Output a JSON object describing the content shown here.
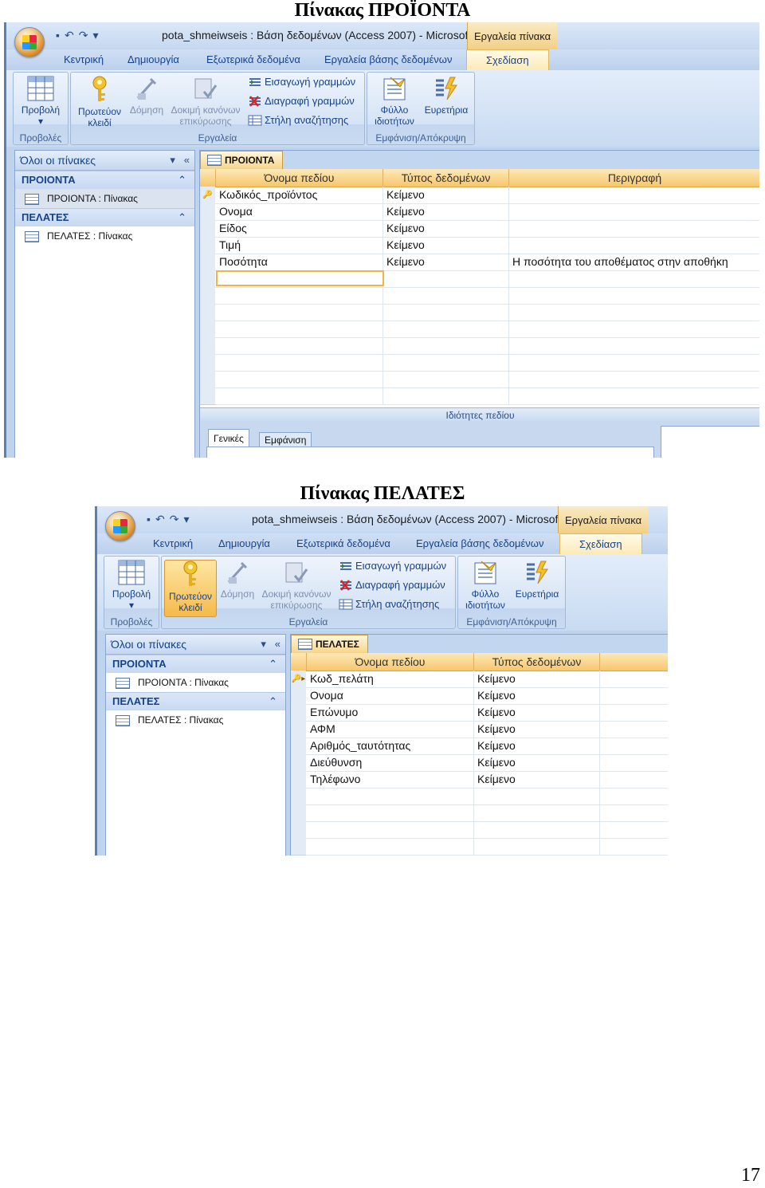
{
  "headings": {
    "products": "Πίνακας ΠΡΟΪΟΝΤΑ",
    "customers": "Πίνακας ΠΕΛΑΤΕΣ"
  },
  "page_number": "17",
  "window": {
    "title": "pota_shmeiwseis : Βάση δεδομένων (Access 2007) - Microsof...",
    "tools_label": "Εργαλεία πίνακα"
  },
  "tabs": [
    "Κεντρική",
    "Δημιουργία",
    "Εξωτερικά δεδομένα",
    "Εργαλεία βάσης δεδομένων",
    "Σχεδίαση"
  ],
  "ribbon": {
    "view": {
      "line1": "Προβολή",
      "line2": "▾",
      "group": "Προβολές"
    },
    "primary_key": {
      "line1": "Πρωτεύον",
      "line2": "κλειδί"
    },
    "builder": {
      "line1": "Δόμηση"
    },
    "test_rules": {
      "line1": "Δοκιμή κανόνων",
      "line2": "επικύρωσης"
    },
    "insert_rows": "Εισαγωγή γραμμών",
    "delete_rows": "Διαγραφή γραμμών",
    "lookup_column": "Στήλη αναζήτησης",
    "tools_group": "Εργαλεία",
    "property_sheet": {
      "line1": "Φύλλο",
      "line2": "ιδιοτήτων"
    },
    "indexes": {
      "line1": "Ευρετήρια"
    },
    "showhide_group": "Εμφάνιση/Απόκρυψη"
  },
  "nav": {
    "header": "Όλοι οι πίνακες",
    "dropdown_glyph": "▾",
    "collapse_glyph": "«",
    "group_glyph": "⌃",
    "groups": [
      {
        "name": "ΠΡΟΙΟΝΤΑ",
        "item": "ΠΡΟΙΟΝΤΑ : Πίνακας"
      },
      {
        "name": "ΠΕΛΑΤΕΣ",
        "item": "ΠΕΛΑΤΕΣ : Πίνακας"
      }
    ]
  },
  "grid_headers": {
    "field_name": "Όνομα πεδίου",
    "data_type": "Τύπος δεδομένων",
    "description": "Περιγραφή"
  },
  "products_table": {
    "tab": "ΠΡΟΙΟΝΤΑ",
    "rows": [
      {
        "name": "Κωδικός_προϊόντος",
        "type": "Κείμενο",
        "desc": ""
      },
      {
        "name": "Ονομα",
        "type": "Κείμενο",
        "desc": ""
      },
      {
        "name": "Είδος",
        "type": "Κείμενο",
        "desc": ""
      },
      {
        "name": "Τιμή",
        "type": "Κείμενο",
        "desc": ""
      },
      {
        "name": "Ποσότητα",
        "type": "Κείμενο",
        "desc": "Η ποσότητα του αποθέματος στην αποθήκη"
      }
    ],
    "field_properties": "Ιδιότητες πεδίου",
    "prop_tabs": [
      "Γενικές",
      "Εμφάνιση"
    ]
  },
  "customers_table": {
    "tab": "ΠΕΛΑΤΕΣ",
    "rows": [
      {
        "name": "Κωδ_πελάτη",
        "type": "Κείμενο"
      },
      {
        "name": "Ονομα",
        "type": "Κείμενο"
      },
      {
        "name": "Επώνυμο",
        "type": "Κείμενο"
      },
      {
        "name": "ΑΦΜ",
        "type": "Κείμενο"
      },
      {
        "name": "Αριθμός_ταυτότητας",
        "type": "Κείμενο"
      },
      {
        "name": "Διεύθυνση",
        "type": "Κείμενο"
      },
      {
        "name": "Τηλέφωνο",
        "type": "Κείμενο"
      }
    ]
  },
  "icons": [
    "key-icon",
    "table-view-icon",
    "builder-icon",
    "test-rules-icon",
    "insert-rows-icon",
    "delete-rows-icon",
    "lookup-column-icon",
    "property-sheet-icon",
    "indexes-icon",
    "office-button-icon"
  ]
}
